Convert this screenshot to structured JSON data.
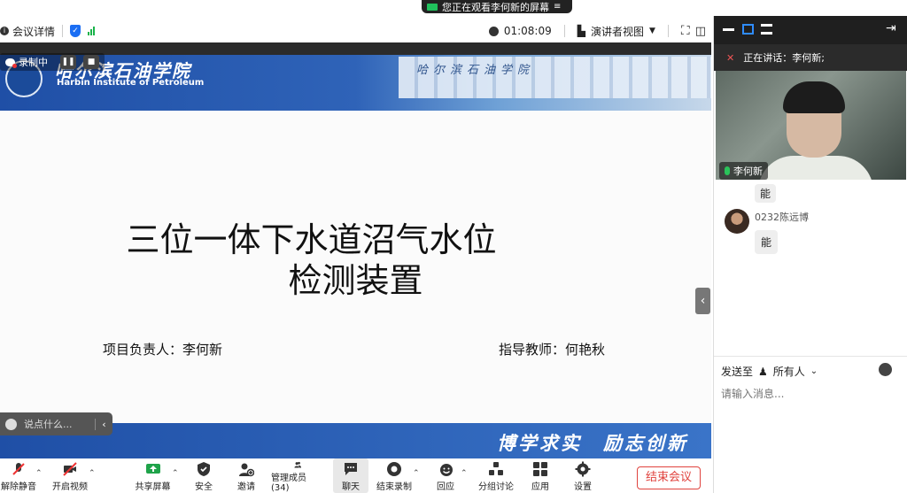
{
  "banner": {
    "text": "您正在观看李何新的屏幕"
  },
  "topbar": {
    "meeting_info": "会议详情",
    "timer": "01:08:09",
    "view_label": "演讲者视图"
  },
  "recording": {
    "label": "录制中"
  },
  "slide": {
    "school_cn": "哈尔滨石油学院",
    "school_en": "Harbin Institute of Petroleum",
    "title_line1": "三位一体下水道沼气水位",
    "title_line2": "检测装置",
    "leader": "项目负责人：李何新",
    "advisor": "指导教师：何艳秋",
    "motto": "博学求实　励志创新",
    "building_text": "哈尔滨石油学院"
  },
  "quick_chat": {
    "placeholder": "说点什么..."
  },
  "panel": {
    "speaking": "正在讲话：李何新;",
    "video_name": "李何新",
    "prev_msg": "能",
    "messages": [
      {
        "sender": "0232陈远博",
        "text": "能"
      }
    ],
    "send_to_label": "发送至",
    "send_to_target": "所有人",
    "input_placeholder": "请输入消息..."
  },
  "toolbar": {
    "unmute": "解除静音",
    "video": "开启视频",
    "share": "共享屏幕",
    "security": "安全",
    "invite": "邀请",
    "members": "管理成员(34)",
    "chat": "聊天",
    "stop_record": "结束录制",
    "reactions": "回应",
    "breakout": "分组讨论",
    "apps": "应用",
    "settings": "设置",
    "end": "结束会议"
  },
  "colors": {
    "accent_blue": "#1b6ef3",
    "end_red": "#e0433e",
    "slide_blue": "#1f4fa6"
  }
}
